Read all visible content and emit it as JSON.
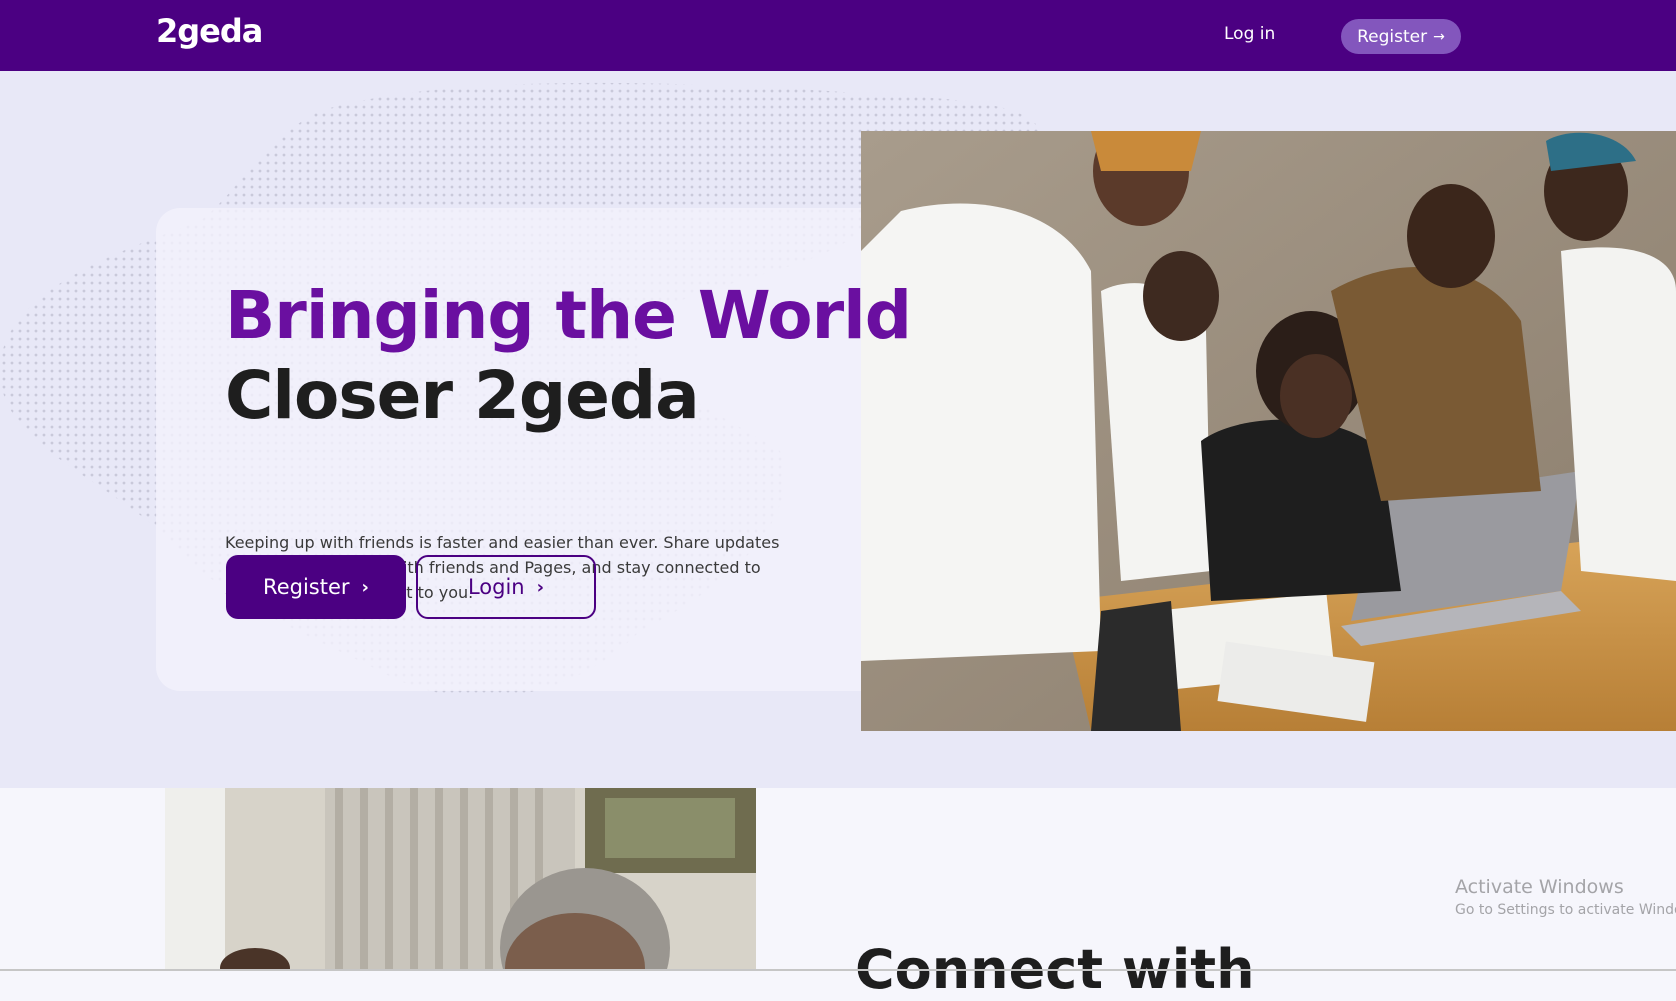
{
  "header": {
    "logo": "2geda",
    "login_label": "Log in",
    "register_label": "Register",
    "register_arrow": "→"
  },
  "hero": {
    "title_line1": "Bringing the World",
    "title_line2": "Closer 2geda",
    "description": "Keeping up with friends is faster and easier than ever. Share updates and photos, engage with friends and Pages, and stay connected to communities important to you.",
    "register_button": "Register",
    "login_button": "Login",
    "chevron": "›"
  },
  "lower": {
    "heading_partial": "Connect with"
  },
  "os_overlay": {
    "title": "Activate Windows",
    "subtitle": "Go to Settings to activate Windows."
  },
  "colors": {
    "brand_purple": "#4b0082",
    "title_purple": "#6a0fa0",
    "nav_register_bg": "#8356bd",
    "hero_bg": "#e8e8f7"
  },
  "icons": {
    "nav_register_arrow": "arrow-right-icon",
    "button_chevron": "chevron-right-icon"
  }
}
